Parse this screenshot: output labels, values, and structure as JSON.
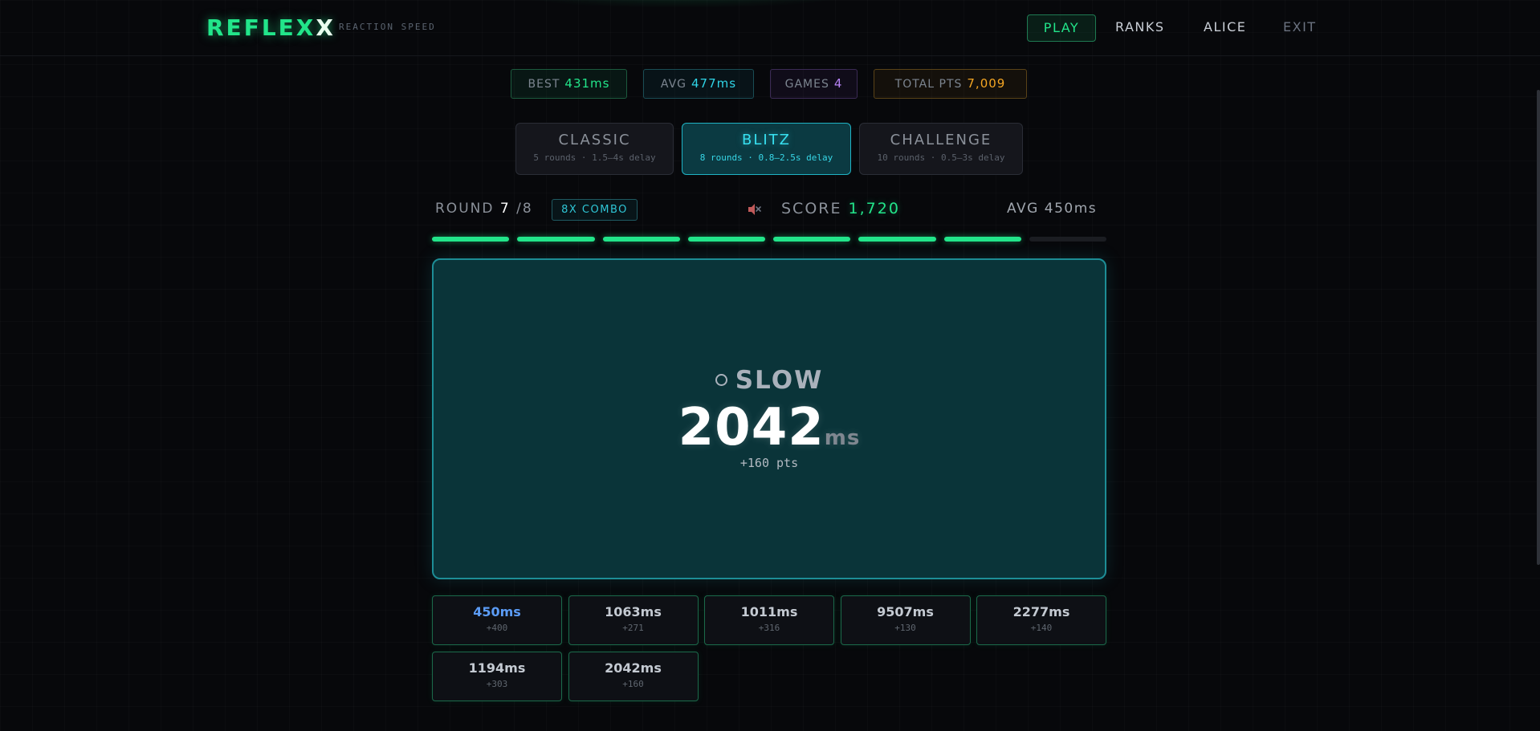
{
  "header": {
    "logo_main": "REFLEX",
    "logo_tail": "X",
    "tagline": "REACTION SPEED",
    "nav": {
      "play": "PLAY",
      "ranks": "RANKS",
      "user": "ALICE",
      "exit": "EXIT"
    }
  },
  "stats": {
    "best": {
      "label": "BEST",
      "value": "431ms"
    },
    "avg": {
      "label": "AVG",
      "value": "477ms"
    },
    "games": {
      "label": "GAMES",
      "value": "4"
    },
    "total": {
      "label": "TOTAL PTS",
      "value": "7,009"
    }
  },
  "modes": {
    "classic": {
      "name": "CLASSIC",
      "desc": "5 rounds · 1.5–4s delay"
    },
    "blitz": {
      "name": "BLITZ",
      "desc": "8 rounds · 0.8–2.5s delay",
      "selected": true
    },
    "challenge": {
      "name": "CHALLENGE",
      "desc": "10 rounds · 0.5–3s delay"
    }
  },
  "status": {
    "round_label": "ROUND",
    "round_current": "7",
    "round_total": "/8",
    "combo": "8X COMBO",
    "mute_icon": "speaker-muted-icon",
    "score_label": "SCORE",
    "score_value": "1,720",
    "avg_text": "AVG 450ms"
  },
  "progress": {
    "total_rounds": 8,
    "completed": 7
  },
  "result": {
    "verdict_icon": "hollow-circle-icon",
    "verdict": "SLOW",
    "time": "2042",
    "unit": "ms",
    "points": "+160 pts"
  },
  "history": [
    {
      "ms": "450ms",
      "pts": "+400",
      "best": true
    },
    {
      "ms": "1063ms",
      "pts": "+271"
    },
    {
      "ms": "1011ms",
      "pts": "+316"
    },
    {
      "ms": "9507ms",
      "pts": "+130"
    },
    {
      "ms": "2277ms",
      "pts": "+140"
    },
    {
      "ms": "1194ms",
      "pts": "+303"
    },
    {
      "ms": "2042ms",
      "pts": "+160"
    }
  ],
  "colors": {
    "accent": "#22e58a",
    "cyan": "#2fd4e6",
    "purple": "#b783f5",
    "amber": "#f5a623",
    "arena": "#0a3439"
  }
}
